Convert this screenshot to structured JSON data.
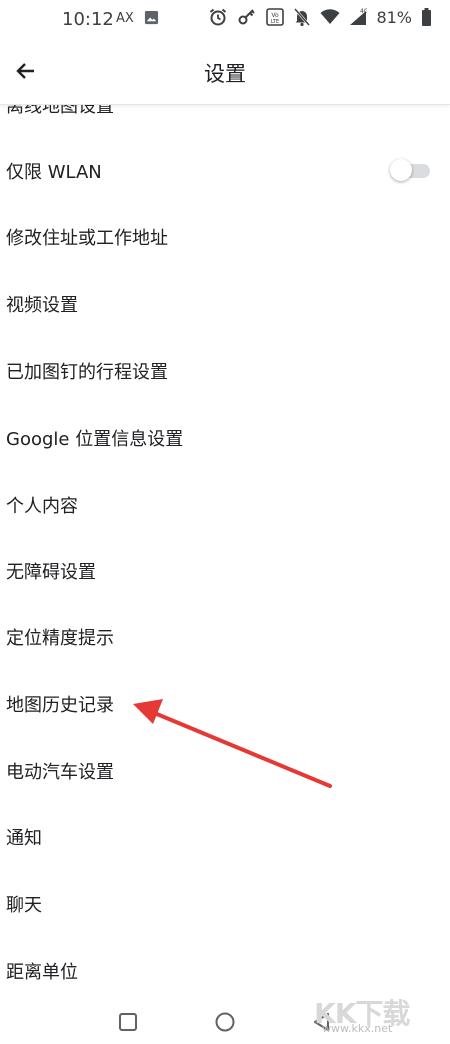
{
  "status_bar": {
    "time": "10:12",
    "ax_label": "AX",
    "battery": "81%",
    "icons": [
      "image-icon",
      "alarm-icon",
      "key-icon",
      "volte-icon",
      "mute-bell-icon",
      "wifi-icon",
      "signal-4g-icon",
      "battery-icon"
    ]
  },
  "app_bar": {
    "title": "设置",
    "back_icon": "arrow-left-icon"
  },
  "list": {
    "partial_top": "离线地图设置",
    "items": [
      {
        "label": "仅限 WLAN",
        "toggle": false
      },
      {
        "label": "修改住址或工作地址"
      },
      {
        "label": "视频设置"
      },
      {
        "label": "已加图钉的行程设置"
      },
      {
        "label": "Google 位置信息设置"
      },
      {
        "label": "个人内容"
      },
      {
        "label": "无障碍设置"
      },
      {
        "label": "定位精度提示"
      },
      {
        "label": "地图历史记录"
      },
      {
        "label": "电动汽车设置"
      },
      {
        "label": "通知"
      },
      {
        "label": "聊天"
      },
      {
        "label": "距离单位"
      }
    ]
  },
  "nav_bar": {
    "icons": [
      "recents-square-icon",
      "home-circle-icon",
      "back-triangle-icon"
    ]
  },
  "annotation": {
    "color": "#e53935",
    "target": "地图历史记录"
  },
  "watermark": {
    "logo": "KK下载",
    "url": "www.kkx.net"
  }
}
